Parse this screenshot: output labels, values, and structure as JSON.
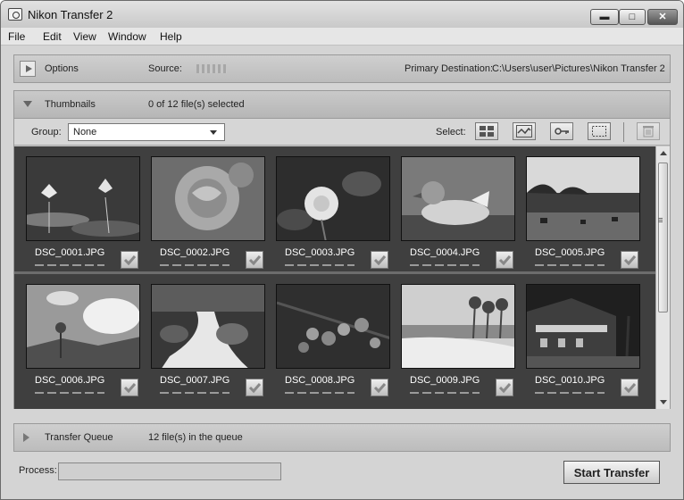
{
  "window": {
    "title": "Nikon Transfer 2",
    "controls": {
      "minimize": "▬",
      "maximize": "□",
      "close": "✕"
    }
  },
  "menu": [
    "File",
    "Edit",
    "View",
    "Window",
    "Help"
  ],
  "options": {
    "label": "Options",
    "source_label": "Source:",
    "destination_label": "Primary Destination:",
    "destination_path": "C:\\Users\\user\\Pictures\\Nikon Transfer 2"
  },
  "thumbnails": {
    "label": "Thumbnails",
    "selection_status": "0 of 12 file(s) selected",
    "group_label": "Group:",
    "group_value": "None",
    "select_label": "Select:",
    "select_icons": [
      "grid-icon",
      "wave-icon",
      "key-icon",
      "marquee-icon"
    ],
    "delete_icon": "trash-icon",
    "items": [
      {
        "name": "DSC_0001.JPG",
        "checked": true,
        "subject": "lotus-flowers"
      },
      {
        "name": "DSC_0002.JPG",
        "checked": true,
        "subject": "rose"
      },
      {
        "name": "DSC_0003.JPG",
        "checked": true,
        "subject": "white-flower"
      },
      {
        "name": "DSC_0004.JPG",
        "checked": true,
        "subject": "duck"
      },
      {
        "name": "DSC_0005.JPG",
        "checked": true,
        "subject": "meadow-horses"
      },
      {
        "name": "DSC_0006.JPG",
        "checked": true,
        "subject": "tree-clouds"
      },
      {
        "name": "DSC_0007.JPG",
        "checked": true,
        "subject": "waterfall"
      },
      {
        "name": "DSC_0008.JPG",
        "checked": true,
        "subject": "berries"
      },
      {
        "name": "DSC_0009.JPG",
        "checked": true,
        "subject": "beach-palms"
      },
      {
        "name": "DSC_0010.JPG",
        "checked": true,
        "subject": "lit-building"
      }
    ]
  },
  "queue": {
    "label": "Transfer Queue",
    "status": "12 file(s) in the queue"
  },
  "process": {
    "label": "Process:",
    "progress": 0
  },
  "actions": {
    "start_label": "Start Transfer"
  },
  "colors": {
    "grid_background": "#3f3f3f",
    "panel": "#c5c5c5",
    "accent": "#777777"
  }
}
